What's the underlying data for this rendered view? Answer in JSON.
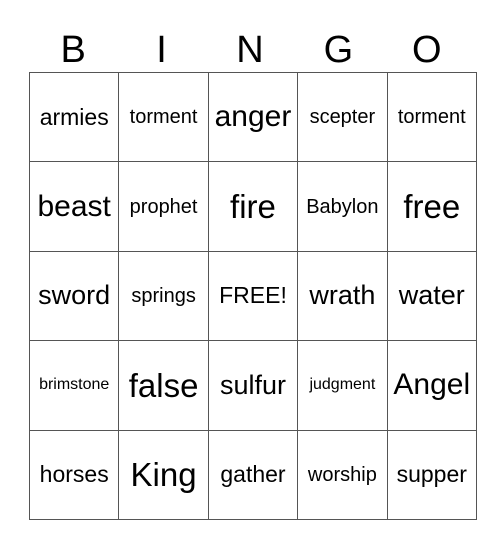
{
  "header": [
    "B",
    "I",
    "N",
    "G",
    "O"
  ],
  "board": [
    [
      "armies",
      "torment",
      "anger",
      "scepter",
      "torment"
    ],
    [
      "beast",
      "prophet",
      "fire",
      "Babylon",
      "free"
    ],
    [
      "sword",
      "springs",
      "FREE!",
      "wrath",
      "water"
    ],
    [
      "brimstone",
      "false",
      "sulfur",
      "judgment",
      "Angel"
    ],
    [
      "horses",
      "King",
      "gather",
      "worship",
      "supper"
    ]
  ]
}
